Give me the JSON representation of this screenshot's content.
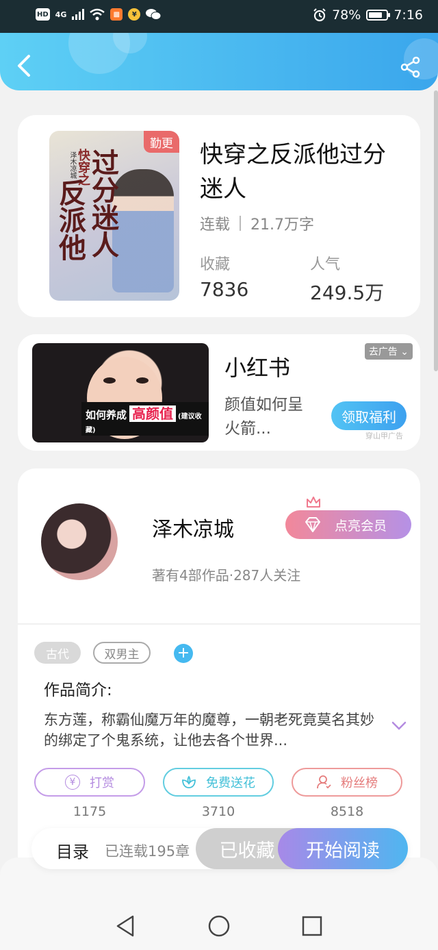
{
  "status_bar": {
    "chips": [
      "HD",
      "4G"
    ],
    "battery_percent_text": "78%",
    "battery_level": 0.78,
    "time": "7:16",
    "icons": [
      "signal-icon",
      "wifi-icon",
      "app-icon",
      "alipay-icon",
      "wechat-icon",
      "alarm-icon",
      "battery-icon"
    ]
  },
  "header": {
    "back_icon": "chevron-left-icon",
    "share_icon": "share-icon",
    "accent_start": "#5ed0f5",
    "accent_end": "#3aa6ec"
  },
  "book": {
    "cover_tag": "勤更",
    "cover_calligraphy": [
      "快穿之",
      "过分迷人",
      "反派他"
    ],
    "cover_author": "泽木凉城",
    "title": "快穿之反派他过分迷人",
    "status": "连载",
    "word_count": "21.7万字",
    "favorites_label": "收藏",
    "favorites_value": "7836",
    "popularity_label": "人气",
    "popularity_value": "249.5万"
  },
  "ad": {
    "title": "小红书",
    "description": "颜值如何呈火箭...",
    "remove_label": "去广告",
    "cta_label": "领取福利",
    "source": "穿山甲广告",
    "image_caption_prefix": "如何养成",
    "image_caption_highlight": "高颜值",
    "image_caption_suffix": "(建议收藏)"
  },
  "author": {
    "name": "泽木凉城",
    "stats": "著有4部作品·287人关注",
    "vip_label": "点亮会员"
  },
  "tags": [
    "古代",
    "双男主"
  ],
  "intro": {
    "title": "作品简介:",
    "text": "东方莲，称霸仙魔万年的魔尊，一朝老死竟莫名其妙的绑定了个鬼系统，让他去各个世界..."
  },
  "actions": [
    {
      "label": "打赏",
      "count": "1175",
      "icon": "yuan-icon"
    },
    {
      "label": "免费送花",
      "count": "3710",
      "icon": "flower-icon"
    },
    {
      "label": "粉丝榜",
      "count": "8518",
      "icon": "user-rank-icon"
    }
  ],
  "bottom_bar": {
    "toc_label": "目录",
    "toc_count": "已连载195章",
    "collect_label": "已收藏",
    "read_label": "开始阅读"
  },
  "nav_bar": {
    "icons": [
      "back-triangle-icon",
      "home-circle-icon",
      "recents-square-icon"
    ]
  }
}
